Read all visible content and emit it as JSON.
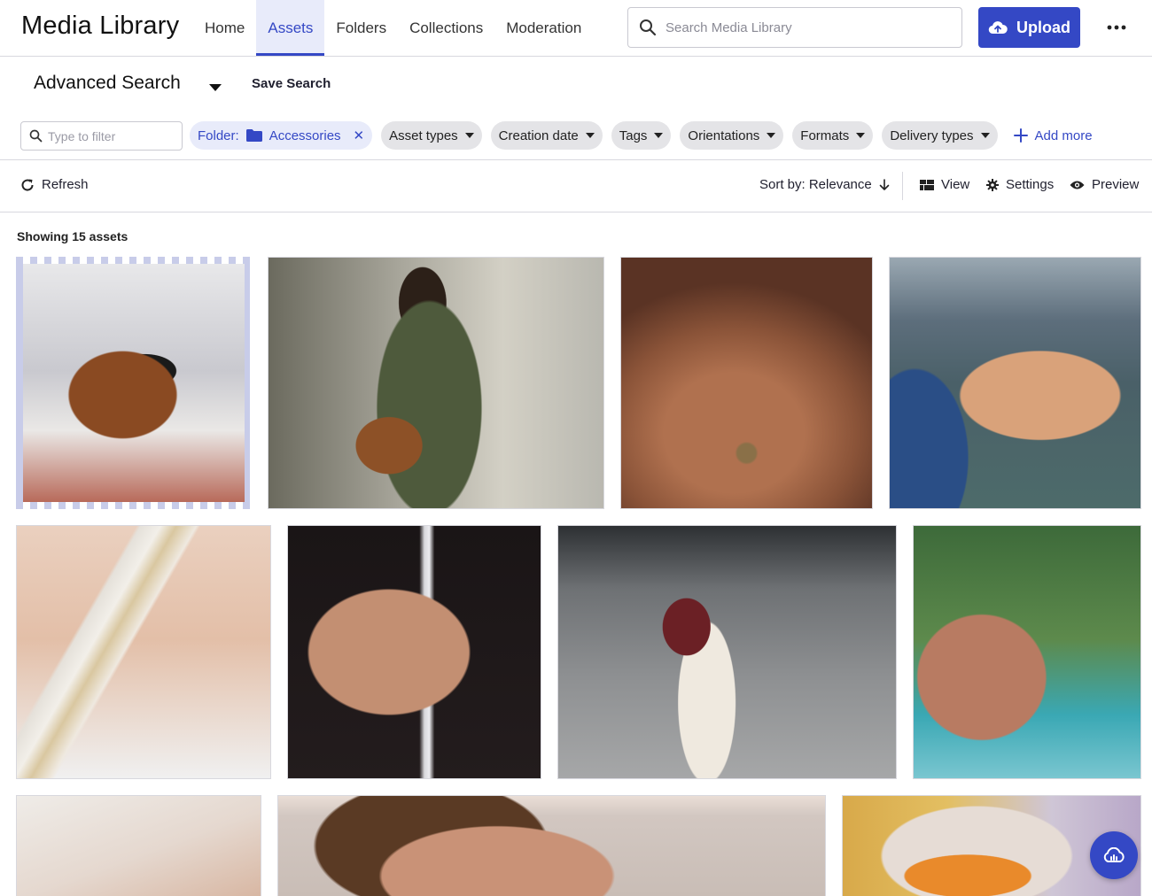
{
  "header": {
    "app_title": "Media Library",
    "nav": [
      {
        "label": "Home",
        "active": false
      },
      {
        "label": "Assets",
        "active": true
      },
      {
        "label": "Folders",
        "active": false
      },
      {
        "label": "Collections",
        "active": false
      },
      {
        "label": "Moderation",
        "active": false
      }
    ],
    "search_placeholder": "Search Media Library",
    "upload_label": "Upload",
    "more_icon": "ellipsis-icon"
  },
  "advanced": {
    "title": "Advanced Search",
    "save_label": "Save Search"
  },
  "filters": {
    "filter_placeholder": "Type to filter",
    "folder_prefix": "Folder:",
    "folder_name": "Accessories",
    "chips": [
      "Asset types",
      "Creation date",
      "Tags",
      "Orientations",
      "Formats",
      "Delivery types"
    ],
    "add_more": "Add more"
  },
  "toolbar": {
    "refresh": "Refresh",
    "sort": "Sort by: Relevance",
    "view": "View",
    "settings": "Settings",
    "preview": "Preview"
  },
  "results": {
    "showing": "Showing 15 assets"
  },
  "colors": {
    "accent": "#3448c5",
    "accent_light": "#e8ebfa",
    "chip_bg": "#e4e4e7"
  }
}
